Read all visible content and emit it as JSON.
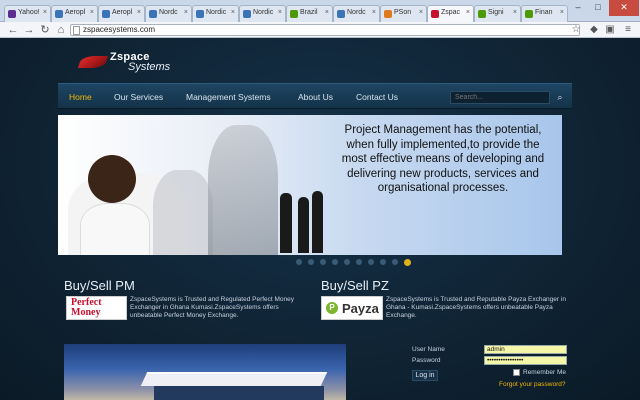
{
  "browser": {
    "tabs": [
      {
        "label": "Yahoo!",
        "color": "#5c2d91"
      },
      {
        "label": "Aeropl",
        "color": "#3b73b9"
      },
      {
        "label": "Aeropl",
        "color": "#3b73b9"
      },
      {
        "label": "Nordc",
        "color": "#3b73b9"
      },
      {
        "label": "Nordic",
        "color": "#3b73b9"
      },
      {
        "label": "Nordic",
        "color": "#3b73b9"
      },
      {
        "label": "Brazil",
        "color": "#4e9a06"
      },
      {
        "label": "Nordc",
        "color": "#3b73b9"
      },
      {
        "label": "PSon",
        "color": "#e07a1f"
      },
      {
        "label": "Zspac",
        "color": "#c8102e"
      },
      {
        "label": "Signi",
        "color": "#4e9a06"
      },
      {
        "label": "Finan",
        "color": "#4e9a06"
      }
    ],
    "active_tab_index": 9,
    "address": "zspacesystems.com"
  },
  "site": {
    "logo": {
      "line1": "Zspace",
      "line2": "Systems"
    },
    "nav": [
      "Home",
      "Our Services",
      "Management Systems",
      "About Us",
      "Contact Us"
    ],
    "active_nav": "Home",
    "search_placeholder": "Search..."
  },
  "banner": {
    "text": "Project Management has the potential, when fully implemented,to provide the most effective means of developing and delivering new products, services and organisational processes.",
    "slide_count": 10,
    "active_slide": 9
  },
  "sections": {
    "pm": {
      "title": "Buy/Sell PM",
      "logo_line1": "Perfect",
      "logo_line2": "Money",
      "desc": "ZspaceSystems is Trusted and Regulated Perfect Money Exchanger in Ghana Kumasi.ZspaceSystems offers unbeatable Perfect Money Exchange."
    },
    "pz": {
      "title": "Buy/Sell PZ",
      "logo_text": "Payza",
      "desc": "ZspaceSystems is Trusted and Reputable Payza Exchanger in Ghana - Kumasi.ZspaceSystems offers unbeatable Payza Exchange."
    }
  },
  "login": {
    "username_label": "User Name",
    "username_value": "admin",
    "password_label": "Password",
    "password_value": "••••••••••••••••",
    "button": "Log in",
    "remember": "Remember Me",
    "forgot": "Forgot your password?"
  },
  "colors": {
    "accent": "#f2b705",
    "nav_bg": "#1e4563",
    "page_bg": "#0f2130"
  }
}
